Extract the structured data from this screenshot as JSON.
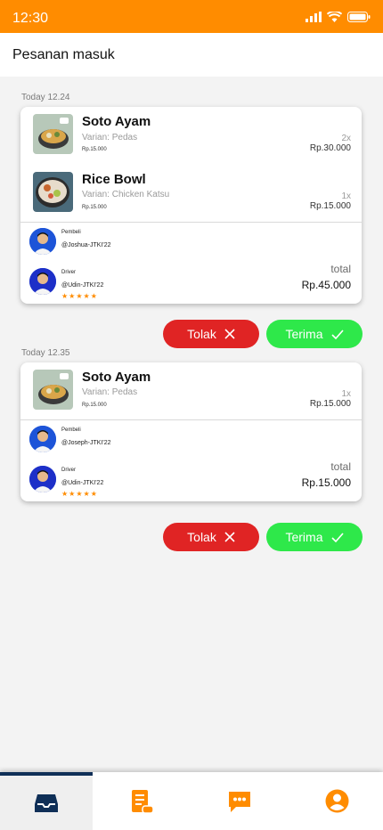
{
  "status_bar": {
    "time": "12:30"
  },
  "header": {
    "title": "Pesanan masuk"
  },
  "orders": [
    {
      "time": "Today 12.24",
      "items": [
        {
          "name": "Soto Ayam",
          "variant": "Varian: Pedas",
          "price": "Rp.15.000",
          "qty": "2x",
          "subtotal": "Rp.30.000",
          "image": "soup-bowl"
        },
        {
          "name": "Rice Bowl",
          "variant": "Varian: Chicken Katsu",
          "price": "Rp.15.000",
          "qty": "1x",
          "subtotal": "Rp.15.000",
          "image": "rice-bowl"
        }
      ],
      "buyer": {
        "role": "Pembeli",
        "handle": "@Joshua-JTKI'22"
      },
      "driver": {
        "role": "Driver",
        "handle": "@Udin-JTKI'22",
        "stars": "★★★★★",
        "rating": 5
      },
      "total_label": "total",
      "total": "Rp.45.000"
    },
    {
      "time": "Today 12.35",
      "items": [
        {
          "name": "Soto Ayam",
          "variant": "Varian: Pedas",
          "price": "Rp.15.000",
          "qty": "1x",
          "subtotal": "Rp.15.000",
          "image": "soup-bowl"
        }
      ],
      "buyer": {
        "role": "Pembeli",
        "handle": "@Joseph-JTKI'22"
      },
      "driver": {
        "role": "Driver",
        "handle": "@Udin-JTKI'22",
        "stars": "★★★★★",
        "rating": 5
      },
      "total_label": "total",
      "total": "Rp.15.000"
    }
  ],
  "actions": {
    "reject_label": "Tolak",
    "accept_label": "Terima"
  },
  "bottom_nav": [
    {
      "icon": "inbox-icon",
      "active": true
    },
    {
      "icon": "receipt-icon",
      "active": false
    },
    {
      "icon": "chat-icon",
      "active": false
    },
    {
      "icon": "profile-icon",
      "active": false
    }
  ],
  "colors": {
    "brand": "#ff8c00",
    "reject": "#e02424",
    "accept": "#2ee84a",
    "nav_active": "#0f2f57"
  }
}
